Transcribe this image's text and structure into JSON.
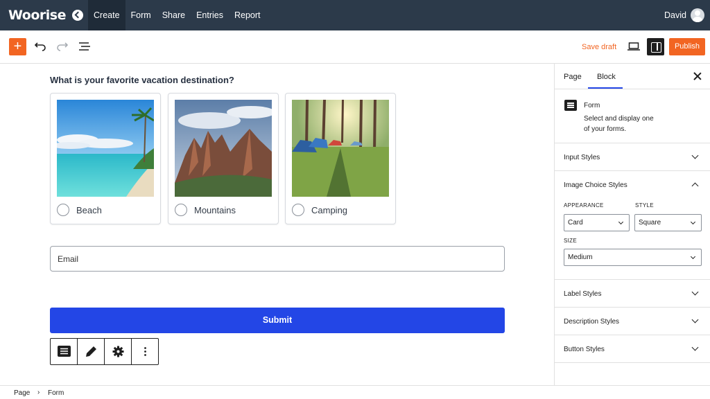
{
  "app": {
    "logo": "Woorise"
  },
  "nav": {
    "links": [
      "Create",
      "Form",
      "Share",
      "Entries",
      "Report"
    ],
    "user": "David"
  },
  "toolbar": {
    "save_draft": "Save draft",
    "publish": "Publish"
  },
  "form": {
    "question": "What is your favorite vacation destination?",
    "choices": [
      {
        "label": "Beach",
        "image": "beach-image"
      },
      {
        "label": "Mountains",
        "image": "mountains-image"
      },
      {
        "label": "Camping",
        "image": "camping-image"
      }
    ],
    "email_placeholder": "Email",
    "submit_label": "Submit"
  },
  "sidebar": {
    "tabs": [
      "Page",
      "Block"
    ],
    "block_name": "Form",
    "block_description": "Select and display one of your forms.",
    "panels": {
      "input_styles": "Input Styles",
      "image_choice_styles": "Image Choice Styles",
      "label_styles": "Label Styles",
      "description_styles": "Description Styles",
      "button_styles": "Button Styles"
    },
    "appearance_label": "APPEARANCE",
    "appearance_value": "Card",
    "style_label": "STYLE",
    "style_value": "Square",
    "size_label": "SIZE",
    "size_value": "Medium"
  },
  "breadcrumb": {
    "page": "Page",
    "form": "Form"
  },
  "colors": {
    "nav_bg": "#2c3a4a",
    "accent": "#f26522",
    "submit": "#2346e6"
  }
}
